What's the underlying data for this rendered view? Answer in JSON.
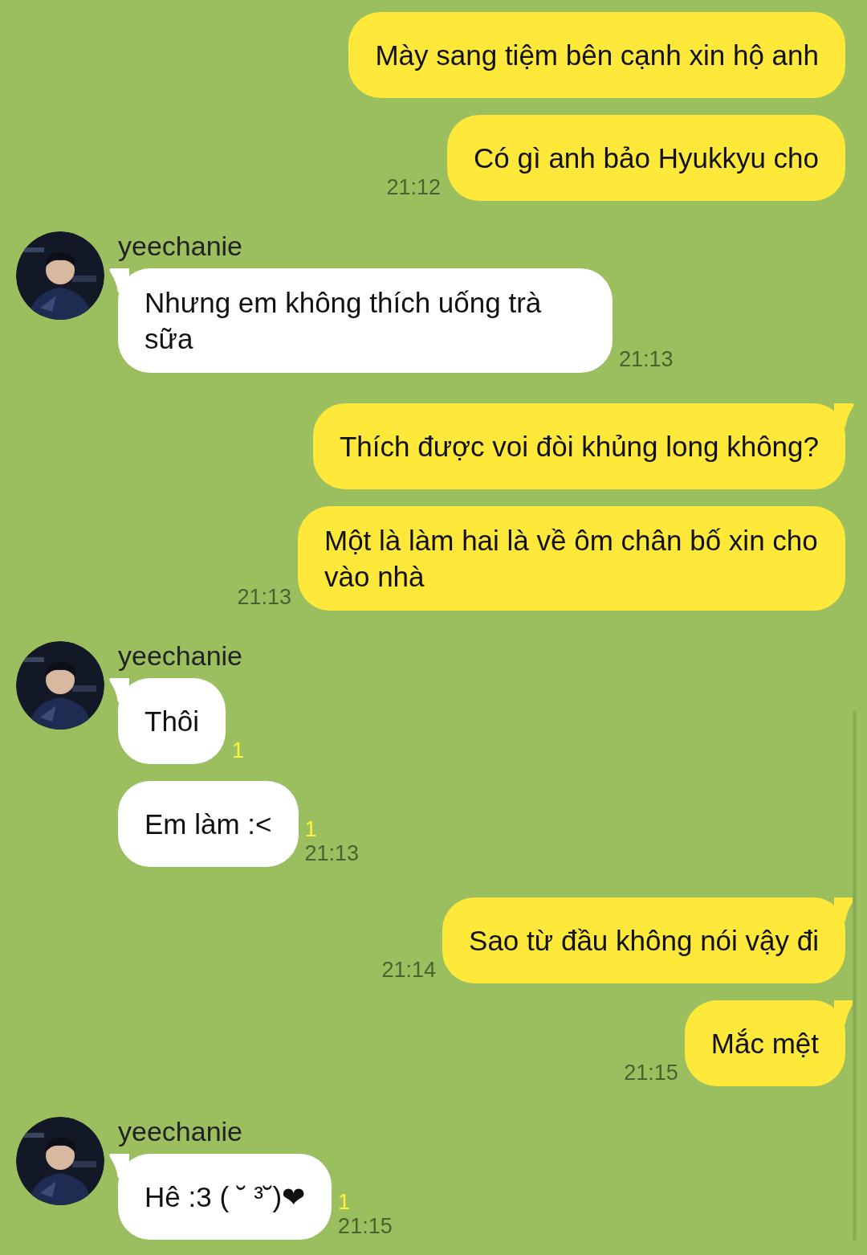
{
  "groups": [
    {
      "kind": "sent",
      "tail": false,
      "messages": [
        {
          "text": "Mày sang tiệm bên cạnh xin hộ anh"
        },
        {
          "text": "Có gì anh bảo Hyukkyu cho",
          "time": "21:12"
        }
      ]
    },
    {
      "kind": "received",
      "tail": true,
      "sender": "yeechanie",
      "avatar": {
        "kind": "picture"
      },
      "messages": [
        {
          "text": "Nhưng em không thích uống trà sữa",
          "time": "21:13"
        }
      ]
    },
    {
      "kind": "sent",
      "tail": true,
      "messages": [
        {
          "text": "Thích được voi đòi khủng long không?"
        },
        {
          "text": "Một là làm hai là về ôm chân bố xin cho vào nhà",
          "time": "21:13"
        }
      ]
    },
    {
      "kind": "received",
      "tail": true,
      "sender": "yeechanie",
      "avatar": {
        "kind": "picture"
      },
      "messages": [
        {
          "text": "Thôi",
          "unread": "1"
        },
        {
          "text": "Em làm :<",
          "unread": "1",
          "time": "21:13"
        }
      ]
    },
    {
      "kind": "sent",
      "tail": true,
      "messages": [
        {
          "text": "Sao từ đầu không nói vậy đi",
          "time": "21:14"
        }
      ]
    },
    {
      "kind": "sent",
      "tail": true,
      "messages": [
        {
          "text": "Mắc mệt",
          "time": "21:15"
        }
      ]
    },
    {
      "kind": "received",
      "tail": true,
      "sender": "yeechanie",
      "avatar": {
        "kind": "picture"
      },
      "messages": [
        {
          "text": "Hê :3 ( ˘ ³˘)❤",
          "unread": "1",
          "time": "21:15"
        }
      ]
    }
  ]
}
